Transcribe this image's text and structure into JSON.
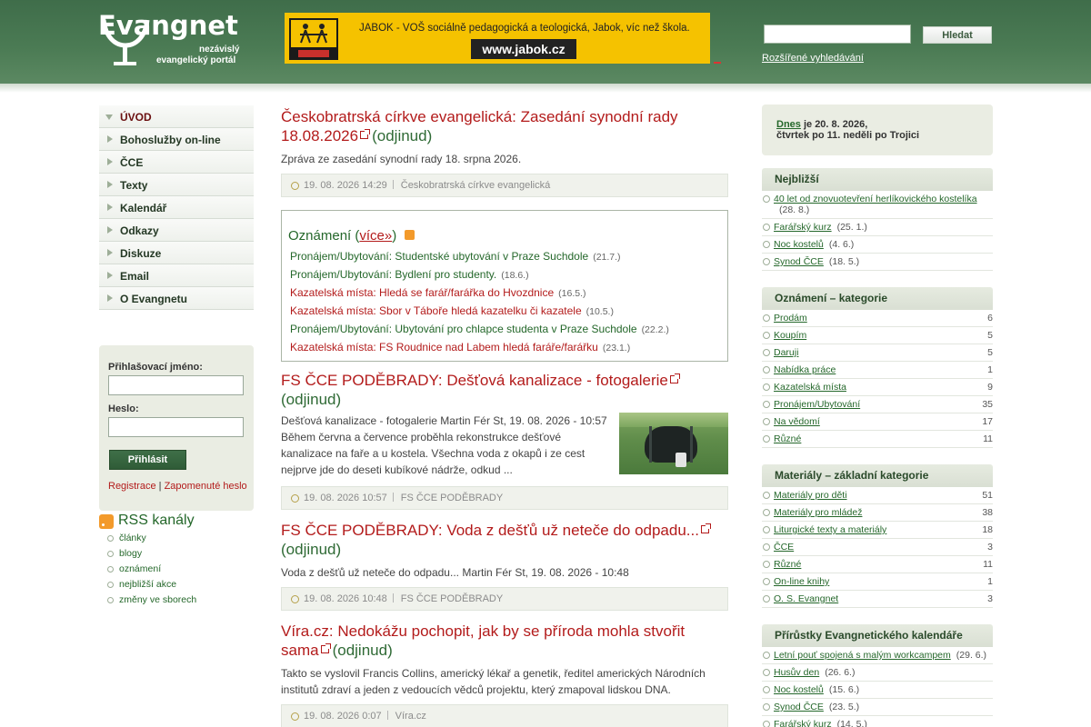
{
  "header": {
    "logo_title": "Evangnet",
    "logo_sub1": "nezávislý",
    "logo_sub2": "evangelický portál",
    "banner_text": "JABOK - VOŠ sociálně pedagogická a teologická, Jabok, víc než škola.",
    "banner_url": "www.jabok.cz",
    "search_button": "Hledat",
    "advanced_search": "Rozšířené vyhledávání"
  },
  "menu": [
    {
      "label": "ÚVOD",
      "active": true
    },
    {
      "label": "Bohoslužby on-line",
      "active": false
    },
    {
      "label": "ČCE",
      "active": false
    },
    {
      "label": "Texty",
      "active": false
    },
    {
      "label": "Kalendář",
      "active": false
    },
    {
      "label": "Odkazy",
      "active": false
    },
    {
      "label": "Diskuze",
      "active": false
    },
    {
      "label": "Email",
      "active": false
    },
    {
      "label": "O Evangnetu",
      "active": false
    }
  ],
  "login": {
    "username_label": "Přihlašovací jméno:",
    "password_label": "Heslo:",
    "button": "Přihlásit",
    "register": "Registrace",
    "separator": "|",
    "forgot": "Zapomenuté heslo"
  },
  "rss": {
    "title": "RSS kanály",
    "items": [
      "články",
      "blogy",
      "oznámení",
      "nejbližší akce",
      "změny ve sborech"
    ]
  },
  "articles": [
    {
      "title": "Českobratrská církve evangelická: Zasedání synodní rady 18.08.2026",
      "source_tag": "(odjinud)",
      "body": "Zpráva ze zasedání synodní rady 18. srpna 2026.",
      "date": "19. 08. 2026 14:29",
      "source": "Českobratrská církve evangelická"
    },
    {
      "title": "FS ČCE PODĚBRADY: Dešťová kanalizace - fotogalerie",
      "source_tag": "(odjinud)",
      "body": "Dešťová kanalizace - fotogalerie Martin Fér St, 19. 08. 2026 - 10:57 Během června a července proběhla rekonstrukce dešťové kanalizace na faře a u kostela. Všechna voda z okapů i ze cest nejprve jde do deseti kubíkové nádrže, odkud ...",
      "date": "19. 08. 2026 10:57",
      "source": "FS ČCE PODĚBRADY"
    },
    {
      "title": "FS ČCE PODĚBRADY: Voda z dešťů už neteče do odpadu...",
      "source_tag": "(odjinud)",
      "body": "Voda z dešťů už neteče do odpadu... Martin Fér St, 19. 08. 2026 - 10:48",
      "date": "19. 08. 2026 10:48",
      "source": "FS ČCE PODĚBRADY"
    },
    {
      "title": "Víra.cz: Nedokážu pochopit, jak by se příroda mohla stvořit sama",
      "source_tag": "(odjinud)",
      "body": "Takto se vyslovil Francis Collins, americký lékař a genetik, ředitel amerických Národních institutů zdraví a jeden z vedoucích vědců projektu, který zmapoval lidskou DNA.",
      "date": "19. 08. 2026 0:07",
      "source": "Víra.cz"
    }
  ],
  "announcements": {
    "title_prefix": "Oznámení (",
    "more": "více»",
    "title_suffix": ")",
    "items": [
      {
        "text": "Pronájem/Ubytování: Studentské ubytování v Praze Suchdole",
        "date": "(21.7.)",
        "color": "green"
      },
      {
        "text": "Pronájem/Ubytování: Bydlení pro studenty.",
        "date": "(18.6.)",
        "color": "green"
      },
      {
        "text": "Kazatelská místa: Hledá se farář/farářka do Hvozdnice",
        "date": "(16.5.)",
        "color": "red"
      },
      {
        "text": "Kazatelská místa: Sbor v Táboře hledá kazatelku či kazatele",
        "date": "(10.5.)",
        "color": "red"
      },
      {
        "text": "Pronájem/Ubytování: Ubytování pro chlapce studenta v Praze Suchdole",
        "date": "(22.2.)",
        "color": "green"
      },
      {
        "text": "Kazatelská místa: FS Roudnice nad Labem hledá faráře/farářku",
        "date": "(23.1.)",
        "color": "red"
      }
    ]
  },
  "today": {
    "link": "Dnes",
    "rest": " je 20. 8. 2026,",
    "line2": "čtvrtek po 11. neděli po Trojici"
  },
  "nearest": {
    "title": "Nejbližší",
    "items": [
      {
        "text": "40 let od znovuotevření herlíkovického kostelíka",
        "note": "(28. 8.)"
      },
      {
        "text": "Farářský kurz",
        "note": "(25. 1.)"
      },
      {
        "text": "Noc kostelů",
        "note": "(4. 6.)"
      },
      {
        "text": "Synod ČCE",
        "note": "(18. 5.)"
      }
    ]
  },
  "ann_categories": {
    "title": "Oznámení – kategorie",
    "items": [
      {
        "text": "Prodám",
        "count": "6"
      },
      {
        "text": "Koupím",
        "count": "5"
      },
      {
        "text": "Daruji",
        "count": "5"
      },
      {
        "text": "Nabídka práce",
        "count": "1"
      },
      {
        "text": "Kazatelská místa",
        "count": "9"
      },
      {
        "text": "Pronájem/Ubytování",
        "count": "35"
      },
      {
        "text": "Na vědomí",
        "count": "17"
      },
      {
        "text": "Různé",
        "count": "11"
      }
    ]
  },
  "materials": {
    "title": "Materiály – základní kategorie",
    "items": [
      {
        "text": "Materiály pro děti",
        "count": "51"
      },
      {
        "text": "Materiály pro mládež",
        "count": "38"
      },
      {
        "text": "Liturgické texty a materiály",
        "count": "18"
      },
      {
        "text": "ČCE",
        "count": "3"
      },
      {
        "text": "Různé",
        "count": "11"
      },
      {
        "text": "On-line knihy",
        "count": "1"
      },
      {
        "text": "O. S. Evangnet",
        "count": "3"
      }
    ]
  },
  "calendar": {
    "title": "Přírůstky Evangnetického kalendáře",
    "items": [
      {
        "text": "Letní pouť spojená s malým workcampem",
        "note": "(29. 6.)"
      },
      {
        "text": "Husův den",
        "note": "(26. 6.)"
      },
      {
        "text": "Noc kostelů",
        "note": "(15. 6.)"
      },
      {
        "text": "Synod ČCE",
        "note": "(23. 5.)"
      },
      {
        "text": "Farářský kurz",
        "note": "(14. 5.)"
      }
    ]
  },
  "colors": {
    "header_green": "#4b7b54",
    "link_green": "#24672a",
    "link_red": "#b31b1b",
    "banner_yellow": "#f5c200"
  }
}
